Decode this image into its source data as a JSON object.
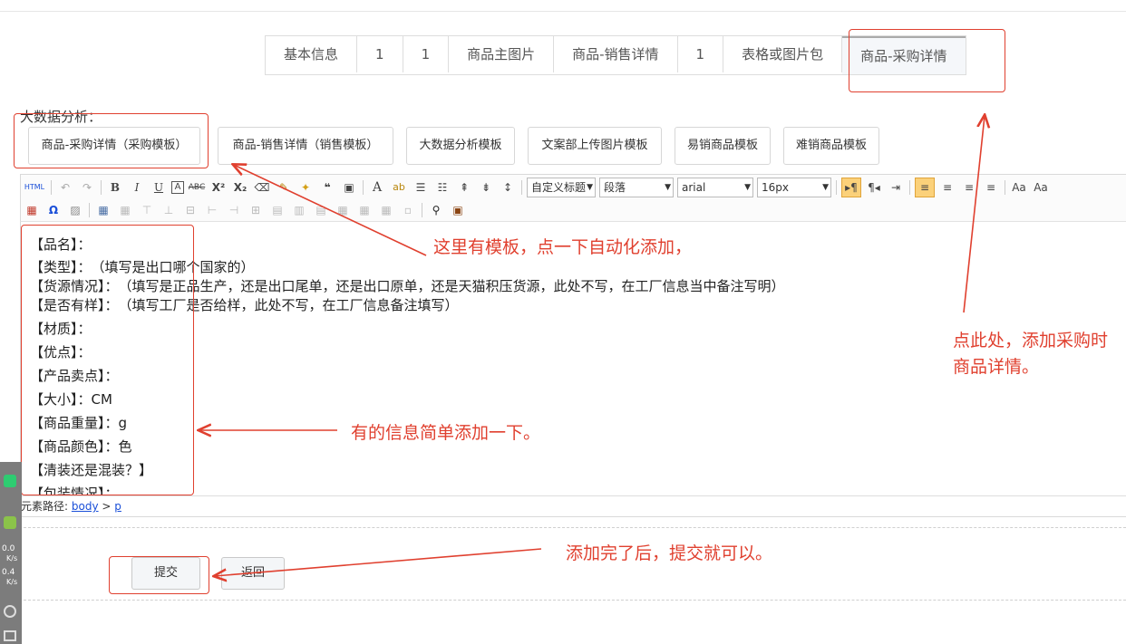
{
  "tabs": [
    "基本信息",
    "1",
    "1",
    "商品主图片",
    "商品-销售详情",
    "1",
    "表格或图片包",
    "商品-采购详情"
  ],
  "big_data_title": "大数据分析：",
  "template_buttons": [
    "商品-采购详情（采购模板）",
    "商品-销售详情（销售模板）",
    "大数据分析模板",
    "文案部上传图片模板",
    "易销商品模板",
    "难销商品模板"
  ],
  "toolbar": {
    "html_label": "HTML",
    "heading_select": "自定义标题",
    "paragraph_select": "段落",
    "font_select": "arial",
    "size_select": "16px"
  },
  "editor_lines": [
    "【品名】：",
    "【类型】：　（填写是出口哪个国家的）",
    "【货源情况】：　（填写是正品生产，还是出口尾单，还是出口原单，还是天猫积压货源，此处不写，在工厂信息当中备注写明）",
    "【是否有样】：　（填写工厂是否给样，此处不写，在工厂信息备注填写）",
    "【材质】：",
    "【优点】：",
    "【产品卖点】：",
    "【大小】：CM",
    "【商品重量】：g",
    "【商品颜色】：色",
    "【清装还是混装？】",
    "【包装情况】："
  ],
  "element_path": {
    "label": "元素路径:",
    "body": "body",
    "sep": ">",
    "p": "p"
  },
  "buttons": {
    "submit": "提交",
    "back": "返回"
  },
  "annotations": {
    "template_note": "这里有模板，点一下自动化添加，",
    "tab_note_line1": "点此处，添加采购时",
    "tab_note_line2": "商品详情。",
    "info_note": "有的信息简单添加一下。",
    "submit_note": "添加完了后，提交就可以。"
  },
  "sidebar": {
    "speed1": "0.0",
    "unit1": "K/s",
    "speed2": "0.4",
    "unit2": "K/s"
  },
  "colors": {
    "annotation_red": "#e0402f",
    "link_blue": "#1a4fd8"
  }
}
